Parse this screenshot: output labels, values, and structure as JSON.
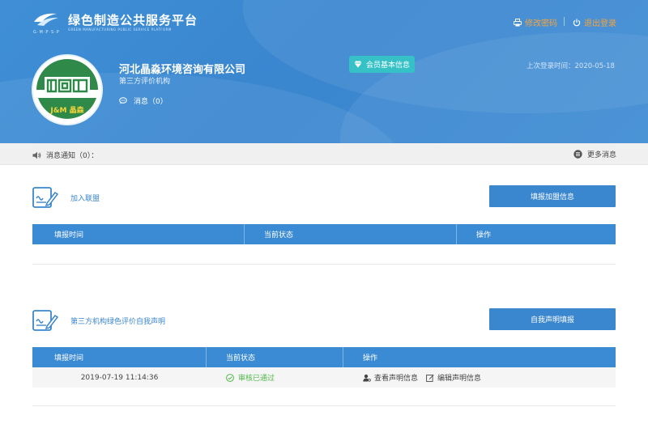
{
  "header": {
    "logo_sub": "G·M·P·S·P",
    "site_title": "绿色制造公共服务平台",
    "site_sub": "GREEN MANUFACTURING PUBLIC SERVICE PLATFORM",
    "change_password": "修改密码",
    "logout": "退出登录"
  },
  "profile": {
    "avatar_text": "J&M 晶森",
    "company_name": "河北晶淼环境咨询有限公司",
    "org_type": "第三方评价机构",
    "messages_label": "消息（0）",
    "member_info_button": "会员基本信息",
    "last_login": "上次登录时间：2020-05-18"
  },
  "notice": {
    "label": "消息通知（0）：",
    "more": "更多消息"
  },
  "join": {
    "title": "加入联盟",
    "button": "填报加盟信息",
    "columns": [
      "填报时间",
      "当前状态",
      "操作"
    ]
  },
  "declaration": {
    "title": "第三方机构绿色评价自我声明",
    "button": "自我声明填报",
    "columns": [
      "填报时间",
      "当前状态",
      "操作"
    ],
    "rows": [
      {
        "time": "2019-07-19 11:14:36",
        "status": "审核已通过",
        "view": "查看声明信息",
        "edit": "编辑声明信息"
      }
    ]
  },
  "colors": {
    "header_blue": "#3a86cf",
    "accent_orange": "#f6a23c",
    "teal": "#35c1c6",
    "success_green": "#52b84a"
  }
}
